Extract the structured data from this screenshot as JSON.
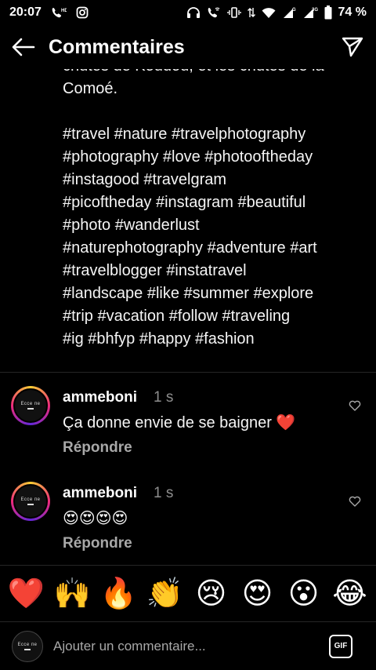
{
  "status_bar": {
    "time": "20:07",
    "battery": "74 %",
    "left_icons": [
      "call-hd-icon",
      "instagram-icon"
    ],
    "right_icons": [
      "headphones-icon",
      "wifi-call-icon",
      "vibrate-icon",
      "data-arrows-icon",
      "wifi-icon",
      "signal-4g-icon",
      "signal-3g-icon",
      "battery-icon"
    ],
    "signal_labels": {
      "sim1": "G",
      "sim2": "3G"
    }
  },
  "header": {
    "title": "Commentaires",
    "back_icon": "arrow-left-icon",
    "share_icon": "send-icon"
  },
  "caption": {
    "text": "chutes de Koudou, et les chutes de la\nComoé.\n\n#travel #nature #travelphotography\n#photography #love #photooftheday\n#instagood #travelgram\n#picoftheday #instagram #beautiful\n#photo #wanderlust\n#naturephotography #adventure #art\n#travelblogger #instatravel\n#landscape #like #summer #explore\n#trip #vacation #follow #traveling\n#ig #bhfyp #happy #fashion"
  },
  "comments": [
    {
      "username": "ammeboni",
      "time": "1 s",
      "text": "Ça donne envie de se baigner ❤️",
      "reply": "Répondre"
    },
    {
      "username": "ammeboni",
      "time": "1 s",
      "text": "😍😍😍😍",
      "reply": "Répondre"
    }
  ],
  "avatar_mark": "Ессе пе",
  "emoji_bar": [
    "❤️",
    "🙌",
    "🔥",
    "👏",
    "😢",
    "😍",
    "😮",
    "😂"
  ],
  "input": {
    "placeholder": "Ajouter un commentaire...",
    "gif_label": "GIF"
  },
  "colors": {
    "background": "#000000",
    "text": "#ffffff",
    "muted": "#8e8e8e",
    "divider": "#262626"
  }
}
